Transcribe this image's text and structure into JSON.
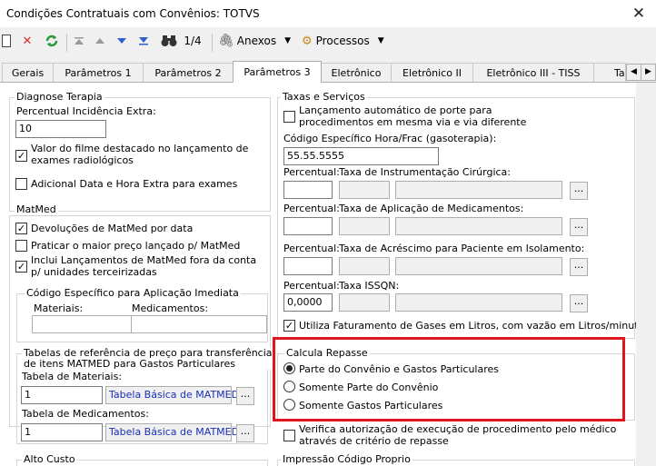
{
  "window": {
    "title": "Condições Contratuais com Convênios: TOTVS",
    "close_glyph": "✕"
  },
  "toolbar": {
    "page_indicator": "1/4",
    "anexos_label": "Anexos",
    "processos_label": "Processos",
    "icons": [
      "new-doc-icon",
      "delete-icon",
      "refresh-icon",
      "first-icon",
      "prev-icon",
      "next-icon",
      "last-icon",
      "binoculars-icon",
      "paperclip-icon",
      "gears-icon"
    ],
    "accent_color": "#2f5fc8",
    "delete_color": "#d92b2b",
    "refresh_color": "#2a9a3a"
  },
  "tabs": [
    {
      "label": "Gerais"
    },
    {
      "label": "Parâmetros 1"
    },
    {
      "label": "Parâmetros 2"
    },
    {
      "label": "Parâmetros 3",
      "active": true
    },
    {
      "label": "Eletrônico"
    },
    {
      "label": "Eletrônico II"
    },
    {
      "label": "Eletrônico III - TISS"
    },
    {
      "label": "Ta"
    }
  ],
  "diagnose": {
    "title": "Diagnose Terapia",
    "percentual_label": "Percentual Incidência Extra:",
    "percentual_value": "10",
    "filme_label_1": "Valor do filme destacado no lançamento de",
    "filme_label_2": "exames radiológicos",
    "filme_checked": true,
    "adicional_label": "Adicional Data e Hora Extra para exames",
    "adicional_checked": false
  },
  "matmed": {
    "title": "MatMed",
    "devolucoes_label": "Devoluções de MatMed por data",
    "devolucoes_checked": true,
    "praticar_label": "Praticar o maior preço lançado p/ MatMed",
    "praticar_checked": false,
    "inclui_label_1": "Inclui Lançamentos de MatMed fora da conta",
    "inclui_label_2": "p/ unidades terceirizadas",
    "inclui_checked": true,
    "codigo_title": "Código Específico para Aplicação Imediata",
    "materiais_col": "Materiais:",
    "medicamentos_col": "Medicamentos:"
  },
  "tabelas": {
    "title_1": "Tabelas de referência de preço para transferência",
    "title_2": "de itens MATMED para Gastos Particulares",
    "materiais_label": "Tabela de Materiais:",
    "materiais_value": "1",
    "materiais_desc": "Tabela Básica de MATMED",
    "medicamentos_label": "Tabela de Medicamentos:",
    "medicamentos_value": "1",
    "medicamentos_desc": "Tabela Básica de MATMED",
    "dots": "..."
  },
  "alto_custo": {
    "title": "Alto Custo"
  },
  "taxas": {
    "title": "Taxas e Serviços",
    "lancamento_label_1": "Lançamento automático de porte para",
    "lancamento_label_2": "procedimentos em mesma via e via diferente",
    "lancamento_checked": false,
    "codigo_label": "Código Específico Hora/Frac (gasoterapia):",
    "codigo_value": "55.55.5555",
    "percentual_label": "Percentual:",
    "instrumentacao_label": "Taxa de Instrumentação Cirúrgica:",
    "aplicacao_label": "Taxa de Aplicação de Medicamentos:",
    "acrescimo_label": "Taxa de Acréscimo para Paciente em Isolamento:",
    "issqn_label": "Taxa ISSQN:",
    "issqn_percentual": "0,0000",
    "utiliza_label": "Utiliza Faturamento de Gases em Litros, com vazão em Litros/minutos",
    "utiliza_checked": true,
    "dots": "..."
  },
  "repasse": {
    "title": "Calcula Repasse",
    "options": [
      {
        "label": "Parte do Convênio e Gastos Particulares",
        "selected": true
      },
      {
        "label": "Somente Parte do Convênio",
        "selected": false
      },
      {
        "label": "Somente Gastos Particulares",
        "selected": false
      }
    ],
    "highlight_color": "#e0161e"
  },
  "verifica": {
    "label_1": "Verifica autorização de execução de procedimento pelo médico",
    "label_2": "através de critério de repasse",
    "checked": false
  },
  "impressao": {
    "title": "Impressão Código Proprio"
  },
  "check_glyph": "✓"
}
